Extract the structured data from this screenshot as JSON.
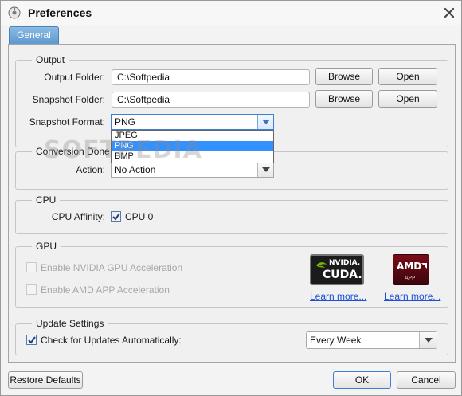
{
  "window": {
    "title": "Preferences"
  },
  "tabs": [
    {
      "label": "General"
    }
  ],
  "output": {
    "group_title": "Output",
    "output_folder_label": "Output Folder:",
    "output_folder_value": "C:\\Softpedia",
    "snapshot_folder_label": "Snapshot Folder:",
    "snapshot_folder_value": "C:\\Softpedia",
    "browse_label": "Browse",
    "open_label": "Open",
    "snapshot_format_label": "Snapshot Format:",
    "snapshot_format_value": "PNG",
    "snapshot_format_options": [
      "JPEG",
      "PNG",
      "BMP"
    ]
  },
  "conversion": {
    "group_title": "Conversion Done",
    "action_label": "Action:",
    "action_value": "No Action"
  },
  "cpu": {
    "group_title": "CPU",
    "affinity_label": "CPU Affinity:",
    "cpu0_label": "CPU 0",
    "cpu0_checked": true
  },
  "gpu": {
    "group_title": "GPU",
    "nvidia_label": "Enable NVIDIA GPU Acceleration",
    "amd_label": "Enable AMD APP Acceleration",
    "nvidia_logo_brand": "NVIDIA.",
    "nvidia_logo_product": "CUDA.",
    "amd_logo_brand": "AMD",
    "amd_logo_product": "APP",
    "learn_more_label": "Learn more...",
    "nvidia_color": "#76b900",
    "amd_color": "#c8102e"
  },
  "updates": {
    "group_title": "Update Settings",
    "auto_check_label": "Check for Updates Automatically:",
    "auto_check_checked": true,
    "frequency_value": "Every Week"
  },
  "footer": {
    "restore_label": "Restore Defaults",
    "ok_label": "OK",
    "cancel_label": "Cancel"
  },
  "watermark": "SOFTPEDIA",
  "colors": {
    "accent": "#3390ff",
    "tab": "#6aa3d8",
    "link": "#1c4fd6"
  },
  "icons": {
    "app": "app-icon",
    "close": "close-icon",
    "dropdown": "chevron-down-icon",
    "check": "check-icon"
  }
}
